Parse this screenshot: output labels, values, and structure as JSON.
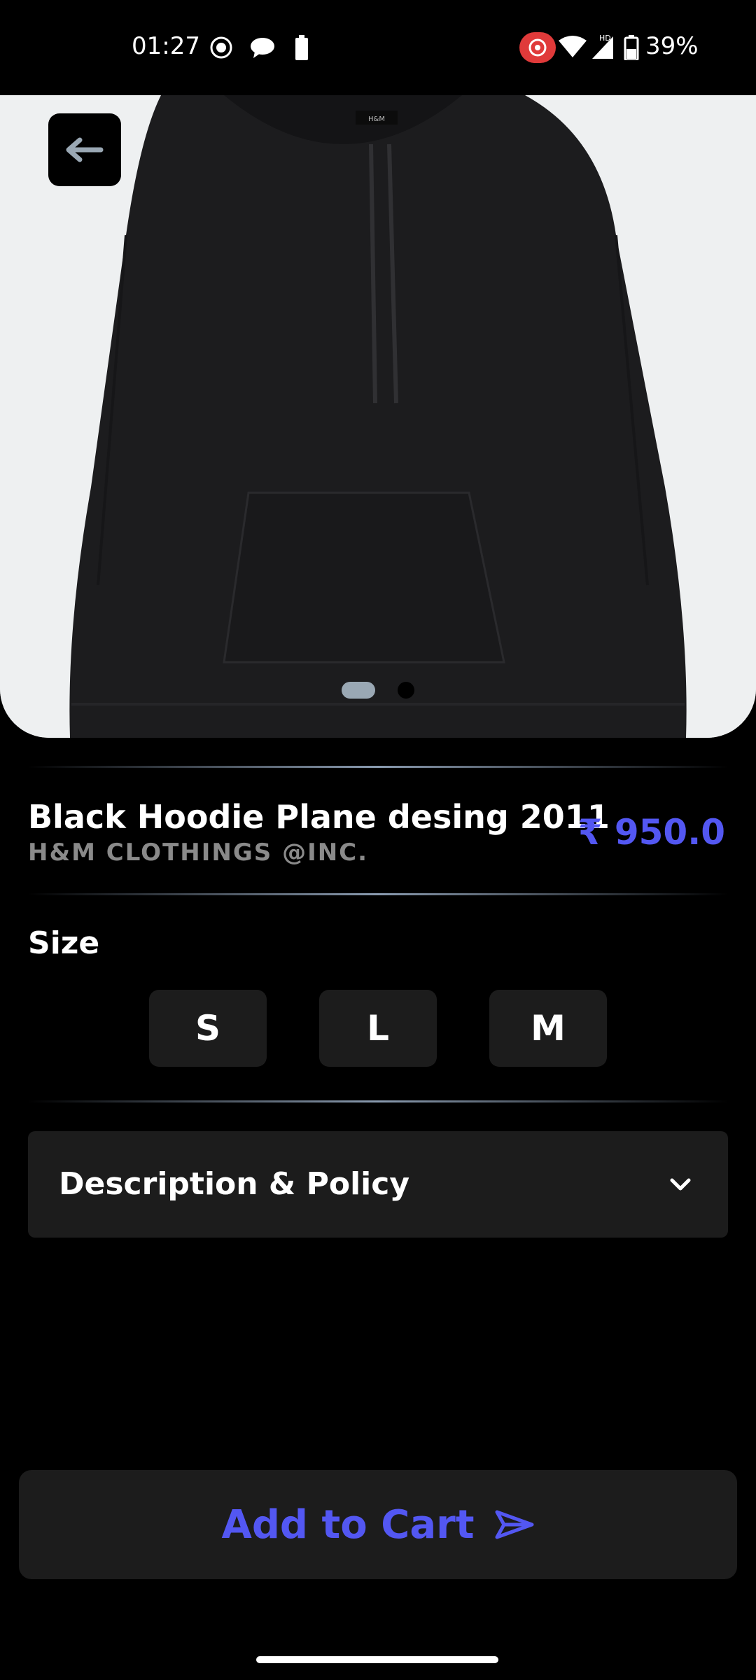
{
  "status_bar": {
    "time": "01:27",
    "battery_percent": "39%",
    "network_label": "HD"
  },
  "carousel": {
    "current_index": 1,
    "total": 2
  },
  "product": {
    "title": "Black Hoodie Plane desing 2011",
    "brand": "H&M CLOTHINGS @INC.",
    "price": "₹ 950.0",
    "hoodie_tag": "H&M"
  },
  "size": {
    "label": "Size",
    "options": [
      "S",
      "L",
      "M"
    ]
  },
  "description": {
    "label": "Description & Policy"
  },
  "cart": {
    "label": "Add to Cart"
  },
  "colors": {
    "accent": "#5357f2",
    "panel": "#1c1c1c",
    "background": "#000000",
    "muted_text": "#8a8a8a"
  },
  "icons": {
    "back": "arrow-left-icon",
    "chevron": "chevron-down-icon",
    "send": "send-icon"
  }
}
